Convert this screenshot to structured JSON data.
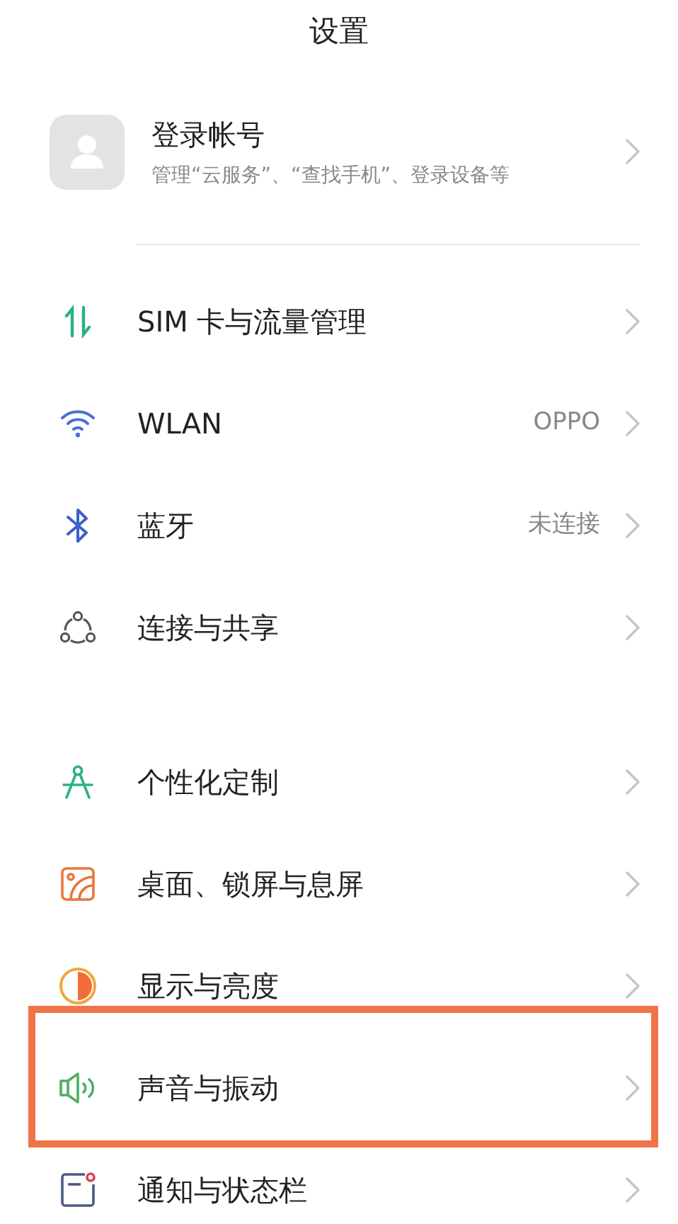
{
  "title": "设置",
  "account": {
    "name": "登录帐号",
    "subtitle": "管理“云服务”、“查找手机”、登录设备等"
  },
  "groups": [
    {
      "items": [
        {
          "kind": "sim",
          "label": "SIM 卡与流量管理",
          "highlighted": false
        },
        {
          "kind": "wifi",
          "label": "WLAN",
          "value": "OPPO",
          "highlighted": false
        },
        {
          "kind": "bluetooth",
          "label": "蓝牙",
          "value": "未连接",
          "highlighted": false
        },
        {
          "kind": "share",
          "label": "连接与共享",
          "highlighted": false
        }
      ]
    },
    {
      "items": [
        {
          "kind": "personalize",
          "label": "个性化定制",
          "highlighted": false
        },
        {
          "kind": "wallpaper",
          "label": "桌面、锁屏与息屏",
          "highlighted": false
        },
        {
          "kind": "display",
          "label": "显示与亮度",
          "highlighted": false
        },
        {
          "kind": "sound",
          "label": "声音与振动",
          "highlighted": true
        },
        {
          "kind": "notification",
          "label": "通知与状态栏",
          "highlighted": false
        }
      ]
    }
  ]
}
